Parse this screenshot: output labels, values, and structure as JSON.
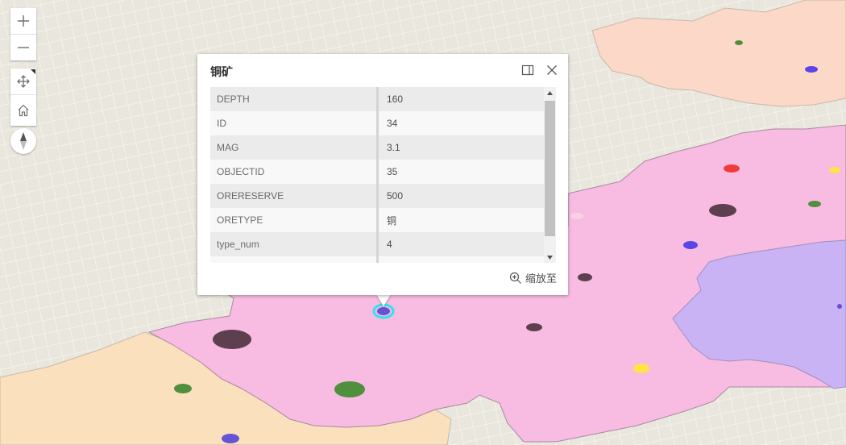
{
  "map": {
    "controls": {
      "zoom_in_icon": "plus-icon",
      "zoom_out_icon": "minus-icon",
      "pan_icon": "move-icon",
      "home_icon": "home-icon",
      "compass_icon": "compass-icon"
    },
    "colors": {
      "ground": "#e9e6dd",
      "region_pink": "#f8bbe1",
      "region_purple": "#c9b3f5",
      "region_peach": "#fbd8c7",
      "region_sand": "#fbe0bd",
      "selection": "#2ee3f0"
    },
    "points": [
      {
        "color": "#4a8f3a"
      },
      {
        "color": "#5a46e8"
      },
      {
        "color": "#ef3b3b"
      },
      {
        "color": "#fde449"
      },
      {
        "color": "#4f8f3e"
      },
      {
        "color": "#f5d2e6"
      },
      {
        "color": "#5e3f50"
      },
      {
        "color": "#5a46e8"
      },
      {
        "color": "#5e3f50"
      },
      {
        "color": "#6552d6"
      },
      {
        "color": "#5e3f50"
      },
      {
        "color": "#fde449"
      },
      {
        "color": "#5e3f50"
      },
      {
        "color": "#4f8f3e"
      },
      {
        "color": "#4f8f3e"
      },
      {
        "color": "#6552d6"
      }
    ]
  },
  "popup": {
    "title": "铜矿",
    "dock_icon": "dock-icon",
    "close_icon": "close-icon",
    "fields": [
      {
        "key": "DEPTH",
        "value": "160"
      },
      {
        "key": "ID",
        "value": "34"
      },
      {
        "key": "MAG",
        "value": "3.1"
      },
      {
        "key": "OBJECTID",
        "value": "35"
      },
      {
        "key": "ORERESERVE",
        "value": "500"
      },
      {
        "key": "ORETYPE",
        "value": "铜"
      },
      {
        "key": "type_num",
        "value": "4"
      },
      {
        "key": "",
        "value": ""
      }
    ],
    "zoom_to_label": "缩放至",
    "zoom_to_icon": "zoom-in-icon"
  }
}
